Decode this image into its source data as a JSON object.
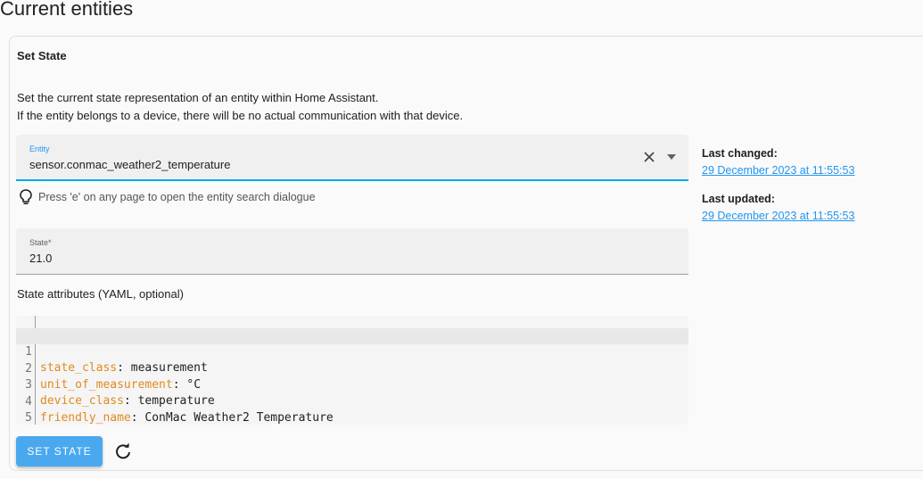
{
  "page": {
    "title": "Current entities"
  },
  "card": {
    "title": "Set State",
    "description_line1": "Set the current state representation of an entity within Home Assistant.",
    "description_line2": "If the entity belongs to a device, there will be no actual communication with that device."
  },
  "entity_field": {
    "label": "Entity",
    "value": "sensor.conmac_weather2_temperature",
    "clear_icon": "close-icon",
    "dropdown_icon": "menu-down-icon"
  },
  "hint": {
    "icon": "lightbulb-outline-icon",
    "text": "Press 'e' on any page to open the entity search dialogue"
  },
  "state_field": {
    "label": "State*",
    "value": "21.0"
  },
  "attributes": {
    "label": "State attributes (YAML, optional)",
    "lines": [
      {
        "number": "1",
        "key": "state_class",
        "value": ": measurement"
      },
      {
        "number": "2",
        "key": "unit_of_measurement",
        "value": ": °C"
      },
      {
        "number": "3",
        "key": "device_class",
        "value": ": temperature"
      },
      {
        "number": "4",
        "key": "friendly_name",
        "value": ": ConMac Weather2 Temperature"
      },
      {
        "number": "5",
        "key": "",
        "value": ""
      }
    ]
  },
  "actions": {
    "set_state_label": "SET STATE",
    "refresh_icon": "refresh-icon"
  },
  "side": {
    "last_changed_label": "Last changed:",
    "last_changed_value": "29 December 2023 at 11:55:53",
    "last_updated_label": "Last updated:",
    "last_updated_value": "29 December 2023 at 11:55:53"
  },
  "colors": {
    "accent": "#03a9f4",
    "button": "#4aa8ee",
    "yaml_key": "#e08a1e",
    "link": "#2196f3"
  }
}
